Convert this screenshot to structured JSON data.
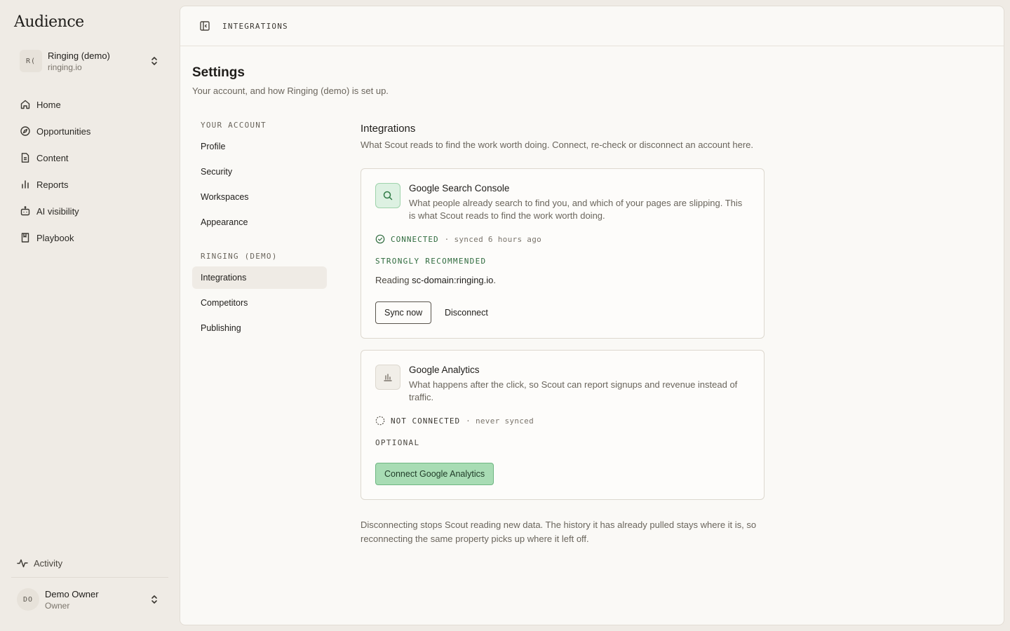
{
  "app": {
    "brand": "Audience"
  },
  "workspace": {
    "avatar": "R(",
    "name": "Ringing (demo)",
    "domain": "ringing.io"
  },
  "nav": {
    "items": [
      {
        "label": "Home",
        "icon": "home-icon"
      },
      {
        "label": "Opportunities",
        "icon": "compass-icon"
      },
      {
        "label": "Content",
        "icon": "document-icon"
      },
      {
        "label": "Reports",
        "icon": "bar-chart-icon"
      },
      {
        "label": "AI visibility",
        "icon": "robot-icon"
      },
      {
        "label": "Playbook",
        "icon": "book-icon"
      }
    ],
    "activity": "Activity"
  },
  "user": {
    "avatar": "DO",
    "name": "Demo Owner",
    "role": "Owner"
  },
  "topbar": {
    "breadcrumb": "INTEGRATIONS"
  },
  "page": {
    "title": "Settings",
    "subtitle": "Your account, and how Ringing (demo) is set up."
  },
  "subnav": {
    "account_heading": "YOUR ACCOUNT",
    "account_items": [
      "Profile",
      "Security",
      "Workspaces",
      "Appearance"
    ],
    "workspace_heading": "RINGING (DEMO)",
    "workspace_items": [
      "Integrations",
      "Competitors",
      "Publishing"
    ],
    "active": "Integrations"
  },
  "integrations": {
    "title": "Integrations",
    "subtitle": "What Scout reads to find the work worth doing. Connect, re-check or disconnect an account here.",
    "gsc": {
      "icon": "search-icon",
      "title": "Google Search Console",
      "description": "What people already search to find you, and which of your pages are slipping. This is what Scout reads to find the work worth doing.",
      "status": "CONNECTED",
      "sync": "· synced 6 hours ago",
      "tag": "STRONGLY RECOMMENDED",
      "reading_prefix": "Reading",
      "reading_value": "sc-domain:ringing.io",
      "reading_suffix": ".",
      "sync_button": "Sync now",
      "disconnect_button": "Disconnect",
      "accent": "#2f6b3e"
    },
    "ga": {
      "icon": "bar-chart-icon",
      "title": "Google Analytics",
      "description": "What happens after the click, so Scout can report signups and revenue instead of traffic.",
      "status": "NOT CONNECTED",
      "sync": "· never synced",
      "tag": "OPTIONAL",
      "connect_button": "Connect Google Analytics",
      "button_color": "#a8dcb4"
    },
    "footnote": "Disconnecting stops Scout reading new data. The history it has already pulled stays where it is, so reconnecting the same property picks up where it left off."
  }
}
